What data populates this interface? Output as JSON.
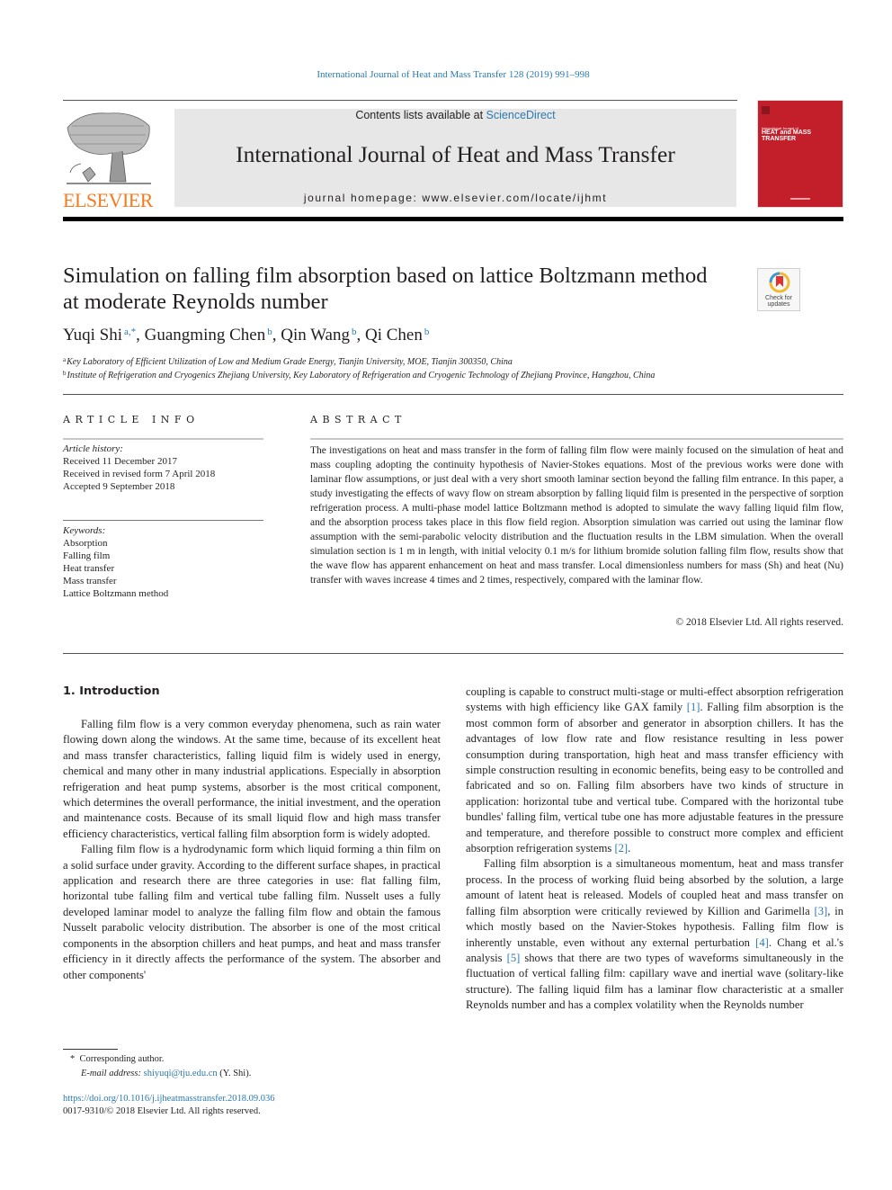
{
  "header": {
    "citation": "International Journal of Heat and Mass Transfer 128 (2019) 991–998",
    "contents_prefix": "Contents lists available at ",
    "contents_link": "ScienceDirect",
    "journal_name": "International Journal of Heat and Mass Transfer",
    "homepage": "journal homepage: www.elsevier.com/locate/ijhmt",
    "publisher_logo_text": "ELSEVIER",
    "cover": {
      "line1": "International Journal of",
      "line2": "HEAT and MASS",
      "line3": "TRANSFER"
    },
    "colors": {
      "link": "#2a7ab0",
      "elsevier_orange": "#f47b20",
      "cover_red": "#c21f2b"
    }
  },
  "article": {
    "title_line1": "Simulation on falling film absorption based on lattice Boltzmann method",
    "title_line2": "at moderate Reynolds number",
    "check_updates": {
      "line1": "Check for",
      "line2": "updates"
    },
    "authors": [
      {
        "name": "Yuqi Shi",
        "sup": "a,*"
      },
      {
        "name": "Guangming Chen",
        "sup": "b"
      },
      {
        "name": "Qin Wang",
        "sup": "b"
      },
      {
        "name": "Qi Chen",
        "sup": "b"
      }
    ],
    "affiliations": [
      {
        "mark": "a",
        "text": "Key Laboratory of Efficient Utilization of Low and Medium Grade Energy, Tianjin University, MOE, Tianjin 300350, China"
      },
      {
        "mark": "b",
        "text": "Institute of Refrigeration and Cryogenics Zhejiang University, Key Laboratory of Refrigeration and Cryogenic Technology of Zhejiang Province, Hangzhou, China"
      }
    ]
  },
  "article_info": {
    "heading": "ARTICLE INFO",
    "history_label": "Article history:",
    "history": [
      "Received 11 December 2017",
      "Received in revised form 7 April 2018",
      "Accepted 9 September 2018"
    ],
    "keywords_label": "Keywords:",
    "keywords": [
      "Absorption",
      "Falling film",
      "Heat transfer",
      "Mass transfer",
      "Lattice Boltzmann method"
    ]
  },
  "abstract": {
    "heading": "ABSTRACT",
    "text": "The investigations on heat and mass transfer in the form of falling film flow were mainly focused on the simulation of heat and mass coupling adopting the continuity hypothesis of Navier-Stokes equations. Most of the previous works were done with laminar flow assumptions, or just deal with a very short smooth laminar section beyond the falling film entrance. In this paper, a study investigating the effects of wavy flow on stream absorption by falling liquid film is presented in the perspective of sorption refrigeration process. A multi-phase model lattice Boltzmann method is adopted to simulate the wavy falling liquid film flow, and the absorption process takes place in this flow field region. Absorption simulation was carried out using the laminar flow assumption with the semi-parabolic velocity distribution and the fluctuation results in the LBM simulation. When the overall simulation section is 1 m in length, with initial velocity 0.1 m/s for lithium bromide solution falling film flow, results show that the wave flow has apparent enhancement on heat and mass transfer. Local dimensionless numbers for mass (Sh) and heat (Nu) transfer with waves increase 4 times and 2 times, respectively, compared with the laminar flow.",
    "copyright": "© 2018 Elsevier Ltd. All rights reserved."
  },
  "body": {
    "section_heading": "1. Introduction",
    "left_paragraphs": [
      "Falling film flow is a very common everyday phenomena, such as rain water flowing down along the windows. At the same time, because of its excellent heat and mass transfer characteristics, falling liquid film is widely used in energy, chemical and many other in many industrial applications. Especially in absorption refrigeration and heat pump systems, absorber is the most critical component, which determines the overall performance, the initial investment, and the operation and maintenance costs. Because of its small liquid flow and high mass transfer efficiency characteristics, vertical falling film absorption form is widely adopted.",
      "Falling film flow is a hydrodynamic form which liquid forming a thin film on a solid surface under gravity. According to the different surface shapes, in practical application and research there are three categories in use: flat falling film, horizontal tube falling film and vertical tube falling film. Nusselt uses a fully developed laminar model to analyze the falling film flow and obtain the famous Nusselt parabolic velocity distribution. The absorber is one of the most critical components in the absorption chillers and heat pumps, and heat and mass transfer efficiency in it directly affects the performance of the system. The absorber and other components'"
    ],
    "right_p1": {
      "a": "coupling is capable to construct multi-stage or multi-effect absorption refrigeration systems with high efficiency like GAX family ",
      "ref1": "[1]",
      "b": ". Falling film absorption is the most common form of absorber and generator in absorption chillers. It has the advantages of low flow rate and flow resistance resulting in less power consumption during transportation, high heat and mass transfer efficiency with simple construction resulting in economic benefits, being easy to be controlled and fabricated and so on. Falling film absorbers have two kinds of structure in application: horizontal tube and vertical tube. Compared with the horizontal tube bundles' falling film, vertical tube one has more adjustable features in the pressure and temperature, and therefore possible to construct more complex and efficient absorption refrigeration systems ",
      "ref2": "[2]",
      "c": "."
    },
    "right_p2": {
      "a": "Falling film absorption is a simultaneous momentum, heat and mass transfer process. In the process of working fluid being absorbed by the solution, a large amount of latent heat is released. Models of coupled heat and mass transfer on falling film absorption were critically reviewed by Killion and Garimella ",
      "ref3": "[3]",
      "b": ", in which mostly based on the Navier-Stokes hypothesis. Falling film flow is inherently unstable, even without any external perturbation ",
      "ref4": "[4]",
      "c": ". Chang et al.'s analysis ",
      "ref5": "[5]",
      "d": " shows that there are two types of waveforms simultaneously in the fluctuation of vertical falling film: capillary wave and inertial wave (solitary-like structure). The falling liquid film has a laminar flow characteristic at a smaller Reynolds number and has a complex volatility when the Reynolds number"
    }
  },
  "footnotes": {
    "corresponding_mark": "*",
    "corresponding": "Corresponding author.",
    "email_label": "E-mail address:",
    "email": "shiyuqi@tju.edu.cn",
    "email_suffix": " (Y. Shi).",
    "doi": "https://doi.org/10.1016/j.ijheatmasstransfer.2018.09.036",
    "issn": "0017-9310/© 2018 Elsevier Ltd. All rights reserved."
  }
}
